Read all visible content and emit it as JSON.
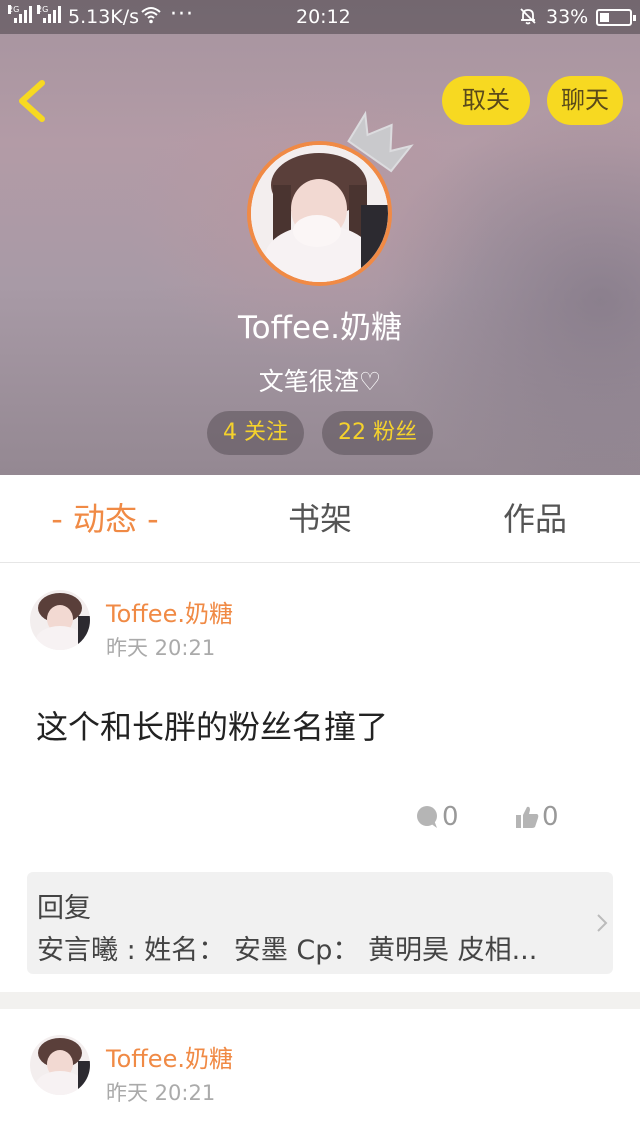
{
  "status_bar": {
    "net1": "2G",
    "net2": "2G",
    "speed": "5.13K/s",
    "more": "···",
    "time": "20:12",
    "battery": "33%",
    "battery_level": 0.33
  },
  "header": {
    "unfollow_label": "取关",
    "chat_label": "聊天",
    "username": "Toffee.奶糖",
    "bio": "文笔很渣♡",
    "following": "4 关注",
    "fans": "22 粉丝"
  },
  "tabs": [
    {
      "label": "- 动态 -",
      "active": true
    },
    {
      "label": "书架",
      "active": false
    },
    {
      "label": "作品",
      "active": false
    }
  ],
  "posts": [
    {
      "author": "Toffee.奶糖",
      "time": "昨天 20:21",
      "body": "这个和长胖的粉丝名撞了",
      "comments": "0",
      "likes": "0",
      "reply_title": "回复",
      "reply_text": "安言曦 : 姓名： 安墨 Cp： 黄明昊 皮相..."
    },
    {
      "author": "Toffee.奶糖",
      "time": "昨天 20:21"
    }
  ],
  "colors": {
    "accent": "#f08a45",
    "button_yellow": "#f7d921",
    "stat_yellow": "#f5d22c"
  }
}
